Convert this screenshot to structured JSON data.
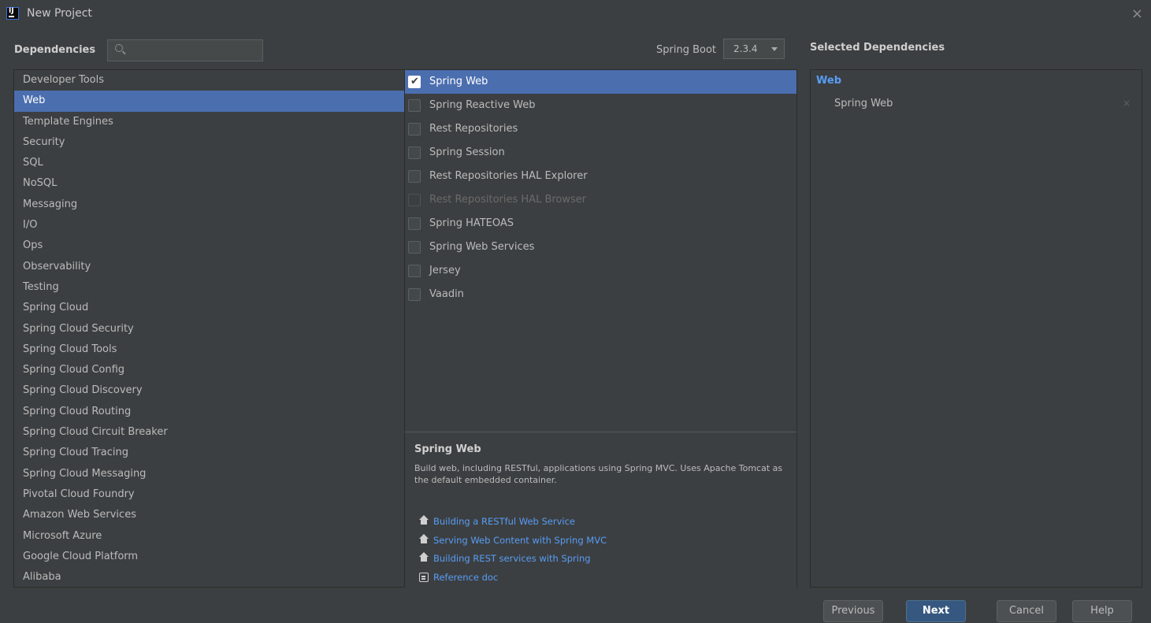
{
  "window": {
    "title": "New Project",
    "close": "×"
  },
  "toolbar": {
    "dependencies_label": "Dependencies",
    "search": {
      "value": "",
      "placeholder": ""
    },
    "spring_boot_label": "Spring Boot",
    "spring_boot_version": "2.3.4"
  },
  "categories": [
    "Developer Tools",
    "Web",
    "Template Engines",
    "Security",
    "SQL",
    "NoSQL",
    "Messaging",
    "I/O",
    "Ops",
    "Observability",
    "Testing",
    "Spring Cloud",
    "Spring Cloud Security",
    "Spring Cloud Tools",
    "Spring Cloud Config",
    "Spring Cloud Discovery",
    "Spring Cloud Routing",
    "Spring Cloud Circuit Breaker",
    "Spring Cloud Tracing",
    "Spring Cloud Messaging",
    "Pivotal Cloud Foundry",
    "Amazon Web Services",
    "Microsoft Azure",
    "Google Cloud Platform",
    "Alibaba"
  ],
  "selected_category": 1,
  "dependencies": [
    {
      "label": "Spring Web",
      "checked": true,
      "disabled": false
    },
    {
      "label": "Spring Reactive Web",
      "checked": false,
      "disabled": false
    },
    {
      "label": "Rest Repositories",
      "checked": false,
      "disabled": false
    },
    {
      "label": "Spring Session",
      "checked": false,
      "disabled": false
    },
    {
      "label": "Rest Repositories HAL Explorer",
      "checked": false,
      "disabled": false
    },
    {
      "label": "Rest Repositories HAL Browser",
      "checked": false,
      "disabled": true
    },
    {
      "label": "Spring HATEOAS",
      "checked": false,
      "disabled": false
    },
    {
      "label": "Spring Web Services",
      "checked": false,
      "disabled": false
    },
    {
      "label": "Jersey",
      "checked": false,
      "disabled": false
    },
    {
      "label": "Vaadin",
      "checked": false,
      "disabled": false
    }
  ],
  "description": {
    "title": "Spring Web",
    "text": "Build web, including RESTful, applications using Spring MVC. Uses Apache Tomcat as the default embedded container.",
    "links": [
      {
        "label": "Building a RESTful Web Service",
        "icon": "home-icon"
      },
      {
        "label": "Serving Web Content with Spring MVC",
        "icon": "home-icon"
      },
      {
        "label": "Building REST services with Spring",
        "icon": "home-icon"
      },
      {
        "label": "Reference doc",
        "icon": "doc-icon"
      }
    ]
  },
  "selected_dependencies": {
    "title": "Selected Dependencies",
    "group": "Web",
    "items": [
      "Spring Web"
    ],
    "remove": "×"
  },
  "buttons": {
    "previous": "Previous",
    "next": "Next",
    "cancel": "Cancel",
    "help": "Help"
  },
  "colors": {
    "background": "#3c3f41",
    "selection": "#4b6eaf",
    "link": "#589df6",
    "primary_button": "#365880"
  }
}
